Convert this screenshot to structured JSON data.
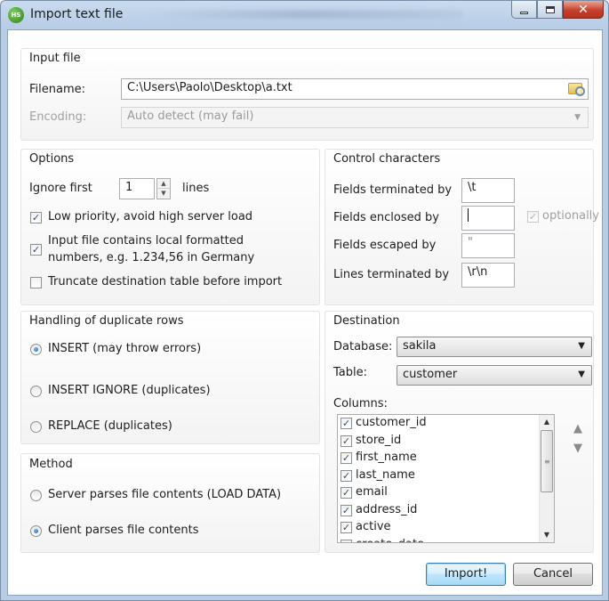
{
  "window": {
    "title": "Import text file",
    "app_icon_text": "HS"
  },
  "input_file": {
    "group_title": "Input file",
    "filename_label": "Filename:",
    "filename_value": "C:\\Users\\Paolo\\Desktop\\a.txt",
    "encoding_label": "Encoding:",
    "encoding_value": "Auto detect (may fail)"
  },
  "options": {
    "group_title": "Options",
    "ignore_first_label": "Ignore first",
    "ignore_first_value": "1",
    "lines_label": "lines",
    "low_priority_label": "Low priority, avoid high server load",
    "low_priority_checked": true,
    "local_format_label_1": "Input file contains local formatted",
    "local_format_label_2": "numbers, e.g. 1.234,56 in Germany",
    "local_format_checked": true,
    "truncate_label": "Truncate destination table before import",
    "truncate_checked": false
  },
  "control_chars": {
    "group_title": "Control characters",
    "fields_terminated_label": "Fields terminated by",
    "fields_terminated_value": "\\t",
    "fields_enclosed_label": "Fields enclosed by",
    "fields_enclosed_value": "",
    "optionally_label": "optionally",
    "fields_escaped_label": "Fields escaped by",
    "fields_escaped_value": "\"",
    "lines_terminated_label": "Lines terminated by",
    "lines_terminated_value": "\\r\\n"
  },
  "duplicates": {
    "group_title": "Handling of duplicate rows",
    "options": [
      "INSERT (may throw errors)",
      "INSERT IGNORE (duplicates)",
      "REPLACE (duplicates)"
    ],
    "selected_index": 0
  },
  "method": {
    "group_title": "Method",
    "options": [
      "Server parses file contents (LOAD DATA)",
      "Client parses file contents"
    ],
    "selected_index": 1
  },
  "destination": {
    "group_title": "Destination",
    "database_label": "Database:",
    "database_value": "sakila",
    "table_label": "Table:",
    "table_value": "customer",
    "columns_label": "Columns:",
    "columns": [
      "customer_id",
      "store_id",
      "first_name",
      "last_name",
      "email",
      "address_id",
      "active",
      "create_date"
    ]
  },
  "buttons": {
    "import_label": "Import!",
    "cancel_label": "Cancel"
  }
}
